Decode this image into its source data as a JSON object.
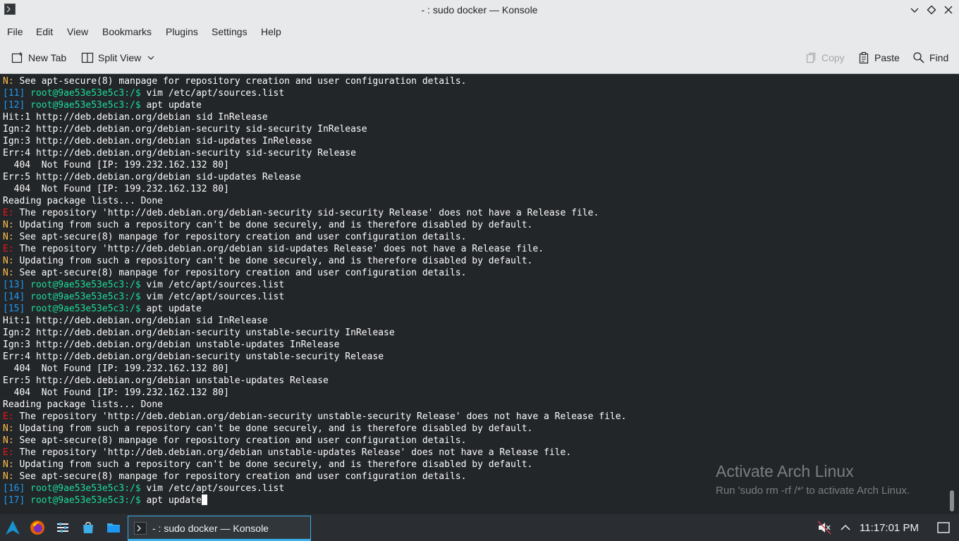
{
  "window": {
    "title": "- : sudo docker — Konsole"
  },
  "menu": [
    "File",
    "Edit",
    "View",
    "Bookmarks",
    "Plugins",
    "Settings",
    "Help"
  ],
  "toolbar": {
    "new_tab": "New Tab",
    "split_view": "Split View",
    "copy": "Copy",
    "paste": "Paste",
    "find": "Find"
  },
  "terminal": {
    "lines": [
      {
        "tag": "N:",
        "tagc": "n",
        "text": " See apt-secure(8) manpage for repository creation and user configuration details."
      },
      {
        "num": "[11]",
        "prompt": "root@9ae53e53e5c3",
        "path": ":/$",
        "text": " vim /etc/apt/sources.list"
      },
      {
        "num": "[12]",
        "prompt": "root@9ae53e53e5c3",
        "path": ":/$",
        "text": " apt update"
      },
      {
        "text": "Hit:1 http://deb.debian.org/debian sid InRelease"
      },
      {
        "text": "Ign:2 http://deb.debian.org/debian-security sid-security InRelease"
      },
      {
        "text": "Ign:3 http://deb.debian.org/debian sid-updates InRelease"
      },
      {
        "text": "Err:4 http://deb.debian.org/debian-security sid-security Release"
      },
      {
        "text": "  404  Not Found [IP: 199.232.162.132 80]"
      },
      {
        "text": "Err:5 http://deb.debian.org/debian sid-updates Release"
      },
      {
        "text": "  404  Not Found [IP: 199.232.162.132 80]"
      },
      {
        "text": "Reading package lists... Done"
      },
      {
        "tag": "E:",
        "tagc": "e",
        "text": " The repository 'http://deb.debian.org/debian-security sid-security Release' does not have a Release file."
      },
      {
        "tag": "N:",
        "tagc": "n",
        "text": " Updating from such a repository can't be done securely, and is therefore disabled by default."
      },
      {
        "tag": "N:",
        "tagc": "n",
        "text": " See apt-secure(8) manpage for repository creation and user configuration details."
      },
      {
        "tag": "E:",
        "tagc": "e",
        "text": " The repository 'http://deb.debian.org/debian sid-updates Release' does not have a Release file."
      },
      {
        "tag": "N:",
        "tagc": "n",
        "text": " Updating from such a repository can't be done securely, and is therefore disabled by default."
      },
      {
        "tag": "N:",
        "tagc": "n",
        "text": " See apt-secure(8) manpage for repository creation and user configuration details."
      },
      {
        "num": "[13]",
        "prompt": "root@9ae53e53e5c3",
        "path": ":/$",
        "text": " vim /etc/apt/sources.list"
      },
      {
        "num": "[14]",
        "prompt": "root@9ae53e53e5c3",
        "path": ":/$",
        "text": " vim /etc/apt/sources.list"
      },
      {
        "num": "[15]",
        "prompt": "root@9ae53e53e5c3",
        "path": ":/$",
        "text": " apt update"
      },
      {
        "text": "Hit:1 http://deb.debian.org/debian sid InRelease"
      },
      {
        "text": "Ign:2 http://deb.debian.org/debian-security unstable-security InRelease"
      },
      {
        "text": "Ign:3 http://deb.debian.org/debian unstable-updates InRelease"
      },
      {
        "text": "Err:4 http://deb.debian.org/debian-security unstable-security Release"
      },
      {
        "text": "  404  Not Found [IP: 199.232.162.132 80]"
      },
      {
        "text": "Err:5 http://deb.debian.org/debian unstable-updates Release"
      },
      {
        "text": "  404  Not Found [IP: 199.232.162.132 80]"
      },
      {
        "text": "Reading package lists... Done"
      },
      {
        "tag": "E:",
        "tagc": "e",
        "text": " The repository 'http://deb.debian.org/debian-security unstable-security Release' does not have a Release file."
      },
      {
        "tag": "N:",
        "tagc": "n",
        "text": " Updating from such a repository can't be done securely, and is therefore disabled by default."
      },
      {
        "tag": "N:",
        "tagc": "n",
        "text": " See apt-secure(8) manpage for repository creation and user configuration details."
      },
      {
        "tag": "E:",
        "tagc": "e",
        "text": " The repository 'http://deb.debian.org/debian unstable-updates Release' does not have a Release file."
      },
      {
        "tag": "N:",
        "tagc": "n",
        "text": " Updating from such a repository can't be done securely, and is therefore disabled by default."
      },
      {
        "tag": "N:",
        "tagc": "n",
        "text": " See apt-secure(8) manpage for repository creation and user configuration details."
      },
      {
        "num": "[16]",
        "prompt": "root@9ae53e53e5c3",
        "path": ":/$",
        "text": " vim /etc/apt/sources.list"
      },
      {
        "num": "[17]",
        "prompt": "root@9ae53e53e5c3",
        "path": ":/$",
        "text": " apt update",
        "cursor": true
      }
    ]
  },
  "watermark": {
    "title": "Activate Arch Linux",
    "subtitle": "Run 'sudo rm -rf /*' to activate Arch Linux."
  },
  "taskbar": {
    "task_label": "- : sudo docker — Konsole",
    "clock": "11:17:01 PM"
  },
  "colors": {
    "terminal_bg": "#232629",
    "prompt": "#1cdc9a",
    "line_number": "#1d99f3",
    "error_tag": "#ed1515",
    "notice_tag": "#fdbc4b",
    "accent": "#3daee9"
  }
}
